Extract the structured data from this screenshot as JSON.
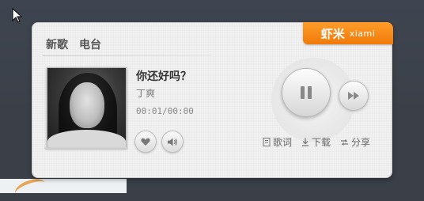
{
  "player": {
    "tabs": [
      "新歌",
      "电台"
    ],
    "logo": {
      "cn": "虾米",
      "en": "xiami"
    },
    "song": {
      "title": "你还好吗？",
      "artist": "丁爽",
      "time": "00:01/00:00"
    },
    "actions": {
      "lyrics": "歌词",
      "download": "下载",
      "share": "分享"
    }
  },
  "colors": {
    "brand_orange": "#f07a0a",
    "panel_bg": "#f1f1f1",
    "desktop_bg": "#3a3f48"
  },
  "icons": {
    "pause": "pause-icon",
    "next": "next-icon",
    "like": "heart-icon",
    "volume": "speaker-icon",
    "lyrics": "document-icon",
    "download": "download-icon",
    "share": "share-icon"
  }
}
